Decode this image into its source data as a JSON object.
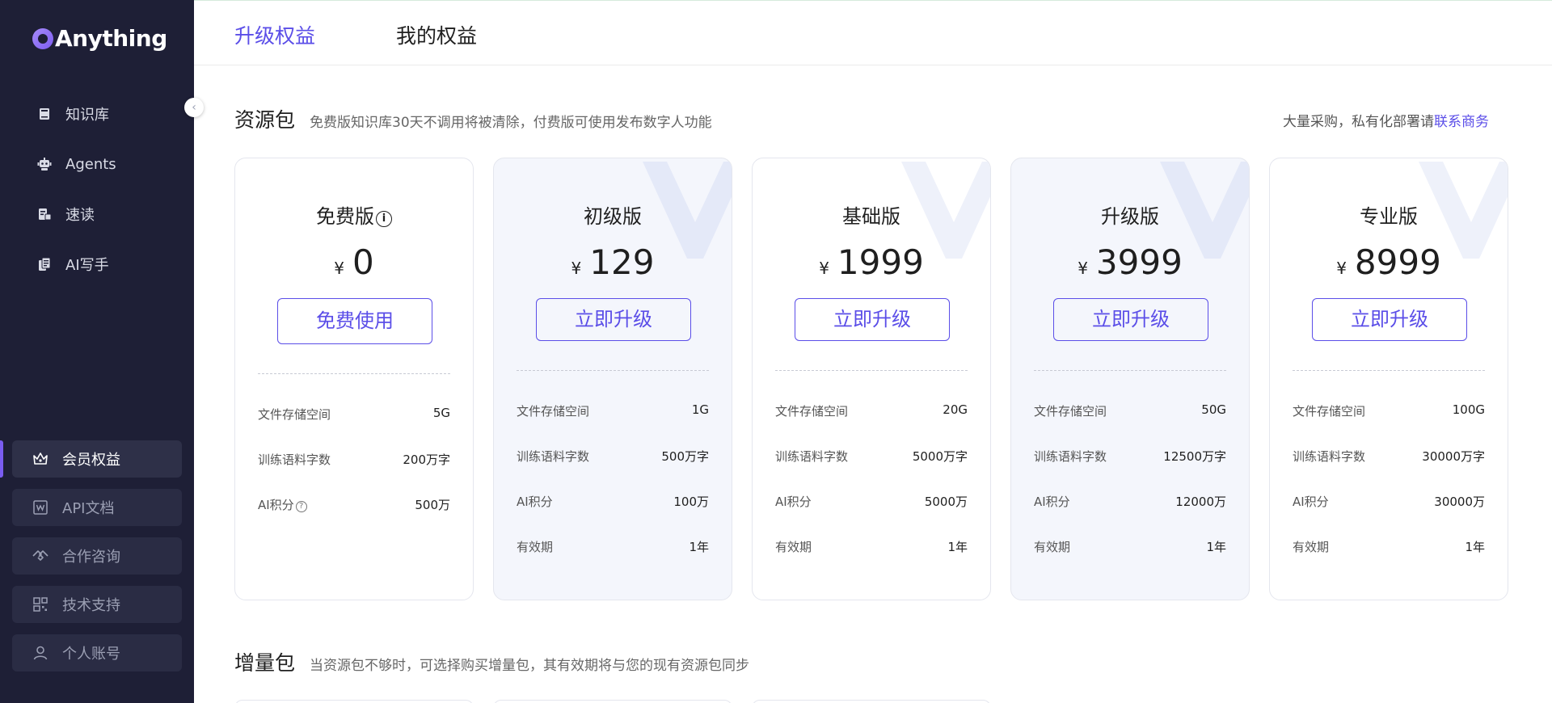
{
  "app": {
    "name": "Anything"
  },
  "sidebar": {
    "top_items": [
      {
        "label": "知识库",
        "icon": "book-icon"
      },
      {
        "label": "Agents",
        "icon": "robot-icon"
      },
      {
        "label": "速读",
        "icon": "speed-read-icon"
      },
      {
        "label": "AI写手",
        "icon": "document-pen-icon"
      }
    ],
    "bottom_items": [
      {
        "label": "会员权益",
        "icon": "crown-icon",
        "active": true
      },
      {
        "label": "API文档",
        "icon": "api-doc-icon"
      },
      {
        "label": "合作咨询",
        "icon": "handshake-icon"
      },
      {
        "label": "技术支持",
        "icon": "grid-icon"
      },
      {
        "label": "个人账号",
        "icon": "user-icon"
      }
    ]
  },
  "tabs": {
    "upgrade": "升级权益",
    "mine": "我的权益"
  },
  "resource_section": {
    "title": "资源包",
    "description": "免费版知识库30天不调用将被清除，付费版可使用发布数字人功能",
    "bulk_text": "大量采购，私有化部署请",
    "bulk_link": "联系商务"
  },
  "plans": [
    {
      "name": "免费版",
      "currency": "¥",
      "price": "0",
      "button": "免费使用",
      "features": [
        {
          "k": "文件存储空间",
          "v": "5G"
        },
        {
          "k": "训练语料字数",
          "v": "200万字"
        },
        {
          "k": "AI积分",
          "v": "500万"
        }
      ]
    },
    {
      "name": "初级版",
      "currency": "¥",
      "price": "129",
      "button": "立即升级",
      "features": [
        {
          "k": "文件存储空间",
          "v": "1G"
        },
        {
          "k": "训练语料字数",
          "v": "500万字"
        },
        {
          "k": "AI积分",
          "v": "100万"
        },
        {
          "k": "有效期",
          "v": "1年"
        }
      ]
    },
    {
      "name": "基础版",
      "currency": "¥",
      "price": "1999",
      "button": "立即升级",
      "features": [
        {
          "k": "文件存储空间",
          "v": "20G"
        },
        {
          "k": "训练语料字数",
          "v": "5000万字"
        },
        {
          "k": "AI积分",
          "v": "5000万"
        },
        {
          "k": "有效期",
          "v": "1年"
        }
      ]
    },
    {
      "name": "升级版",
      "currency": "¥",
      "price": "3999",
      "button": "立即升级",
      "features": [
        {
          "k": "文件存储空间",
          "v": "50G"
        },
        {
          "k": "训练语料字数",
          "v": "12500万字"
        },
        {
          "k": "AI积分",
          "v": "12000万"
        },
        {
          "k": "有效期",
          "v": "1年"
        }
      ]
    },
    {
      "name": "专业版",
      "currency": "¥",
      "price": "8999",
      "button": "立即升级",
      "features": [
        {
          "k": "文件存储空间",
          "v": "100G"
        },
        {
          "k": "训练语料字数",
          "v": "30000万字"
        },
        {
          "k": "AI积分",
          "v": "30000万"
        },
        {
          "k": "有效期",
          "v": "1年"
        }
      ]
    }
  ],
  "increment_section": {
    "title": "增量包",
    "description": "当资源包不够时，可选择购买增量包，其有效期将与您的现有资源包同步"
  },
  "colors": {
    "accent": "#5b4ee8",
    "sidebar_bg": "#1e1f36",
    "card_tint": "#f4f6fc"
  }
}
